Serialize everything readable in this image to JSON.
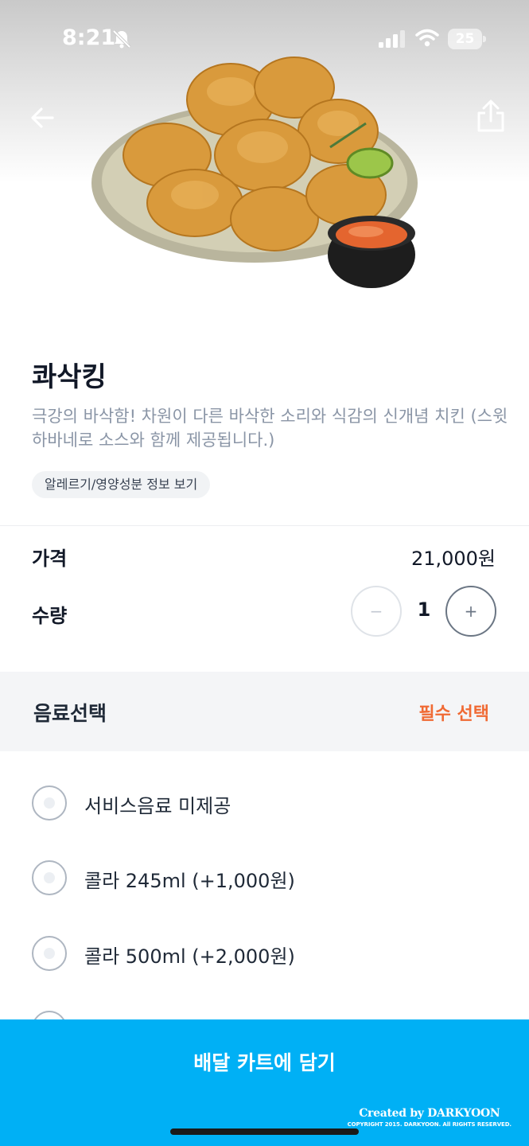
{
  "status_bar": {
    "time": "8:21",
    "battery": "25"
  },
  "product": {
    "name": "콰삭킹",
    "description": "극강의 바삭함! 차원이 다른 바삭한 소리와 식감의 신개념 치킨 (스윗 하바네로 소스와 함께 제공됩니다.)",
    "allergy_chip": "알레르기/영양성분 정보 보기"
  },
  "price": {
    "label": "가격",
    "value": "21,000원"
  },
  "quantity": {
    "label": "수량",
    "value": "1",
    "minus": "−",
    "plus": "+"
  },
  "options": {
    "title": "음료선택",
    "required_label": "필수 선택",
    "items": [
      {
        "label": "서비스음료 미제공"
      },
      {
        "label": "콜라 245ml (+1,000원)"
      },
      {
        "label": "콜라 500ml (+2,000원)"
      }
    ]
  },
  "cta": {
    "label": "배달 카트에 담기"
  },
  "credit": {
    "main": "Created by DARKYOON",
    "sub": "COPYRIGHT 2015. DARKYOON. All RIGHTS RESERVED."
  },
  "colors": {
    "accent": "#00b0f5",
    "required": "#f06a34"
  },
  "icons": {
    "back": "arrow-left-icon",
    "share": "share-icon",
    "silent": "bell-slash-icon"
  }
}
